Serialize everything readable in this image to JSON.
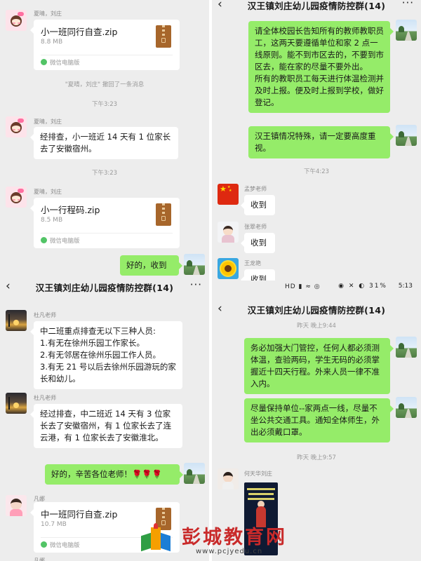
{
  "group_title": "汉王镇刘庄幼儿园疫情防控群(14)",
  "header_icons": {
    "back": "chevron-left-icon",
    "more": "more-dots-icon"
  },
  "source_label": "微信电脑版",
  "panel_tl": {
    "file1": {
      "sender": "夏晴，刘庄",
      "name": "小一班同行自查.zip",
      "size": "8.8 MB"
    },
    "recall_notice": "\"夏晴，刘庄\" 撤回了一条消息",
    "time1": "下午3:23",
    "text_msg": {
      "sender": "夏晴，刘庄",
      "text": "经排查，小一班近 14 天有 1 位家长去了安徽宿州。"
    },
    "time2": "下午3:23",
    "file2": {
      "sender": "夏晴，刘庄",
      "name": "小一行程码.zip",
      "size": "8.5 MB"
    },
    "reply": "好的，收到"
  },
  "panel_tr": {
    "notice1": "请全体校园长告知所有的教师教职员工，这两天要遵循单位和家 2 点一线原则。能不到市区去的，不要到市区去，能在家的尽量不要外出。\n所有的教职员工每天进行体温检测并及时上报。便及时上报到学校，做好登记。",
    "notice2": "汉王镇情况特殊，请一定要高度重视。",
    "time": "下午4:23",
    "replies": [
      {
        "sender": "孟梦老师",
        "text": "收到"
      },
      {
        "sender": "张翠老师",
        "text": "收到"
      },
      {
        "sender": "王龙艳",
        "text": "收到"
      }
    ]
  },
  "panel_bl": {
    "msg1": {
      "sender": "杜凡老师",
      "text": "中二班重点排查无以下三种人员:\n1.有无在徐州乐园工作家长。\n2.有无邻居在徐州乐园工作人员。\n3.有无 21 号以后去徐州乐园游玩的家长和幼儿。"
    },
    "msg2": {
      "sender": "杜凡老师",
      "text": "经过排查，中二班近 14 天有 3 位家长去了安徽宿州，有 1 位家长去了连云港，有 1 位家长去了安徽淮北。"
    },
    "reply": "好的，辛苦各位老师！🌹🌹🌹",
    "file": {
      "sender": "凡娜",
      "name": "中一班同行自查.zip",
      "size": "10.7 MB"
    },
    "next_sender": "凡娜"
  },
  "panel_br": {
    "status_left": "HD ▮ ≈ ◎",
    "status_icons": "◉ ✕ ◐",
    "battery": "31%",
    "clock": "5:13",
    "time1": "昨天 晚上9:44",
    "notice1": "务必加强大门管控，任何人都必须测体温，查验两码，学生无码的必须掌握近十四天行程。外来人员一律不准入内。",
    "notice2": "尽量保持单位--家两点一线，尽量不坐公共交通工具。通知全体师生，外出必须戴口罩。",
    "time2": "昨天 晚上9:57",
    "poster_sender": "何天华刘庄"
  },
  "watermark": {
    "brand": "彭城教育网",
    "url": "www.pcjyedu.cn"
  },
  "colors": {
    "background": "#ededed",
    "incoming_bubble": "#ffffff",
    "outgoing_bubble": "#95ec69",
    "meta_text": "#999999",
    "watermark_red": "#c92a2a"
  }
}
